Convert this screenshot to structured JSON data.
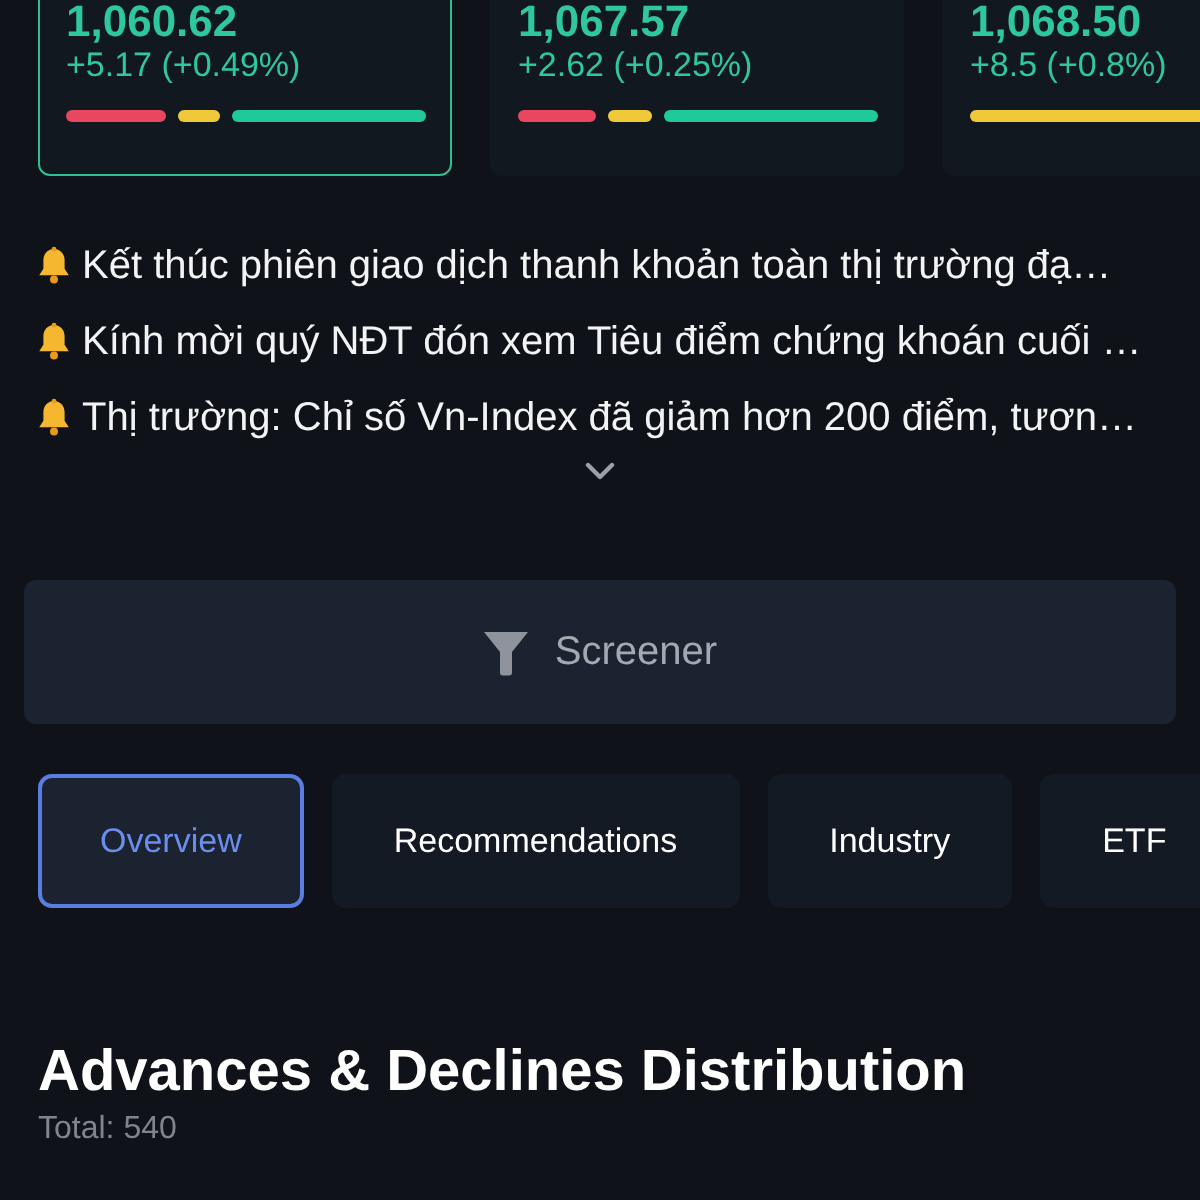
{
  "index_cards": [
    {
      "value": "1,060.62",
      "change": "+5.17 (+0.49%)",
      "selected": true
    },
    {
      "value": "1,067.57",
      "change": "+2.62 (+0.25%)",
      "selected": false
    },
    {
      "value": "1,068.50",
      "change": "+8.5 (+0.8%)",
      "selected": false
    }
  ],
  "news": [
    {
      "text": "Kết thúc phiên giao dịch thanh khoản toàn thị trường đạ…"
    },
    {
      "text": "Kính mời quý NĐT đón xem Tiêu điểm chứng khoán cuối …"
    },
    {
      "text": "Thị trường: Chỉ số Vn-Index đã giảm hơn 200 điểm, tươn…"
    }
  ],
  "news_toggle": {
    "expanded": false
  },
  "screener_button": {
    "label": "Screener"
  },
  "tabs": [
    {
      "label": "Overview",
      "selected": true
    },
    {
      "label": "Recommendations",
      "selected": false
    },
    {
      "label": "Industry",
      "selected": false
    },
    {
      "label": "ETF",
      "selected": false
    }
  ],
  "section": {
    "title": "Advances & Declines Distribution",
    "total": "Total: 540"
  }
}
